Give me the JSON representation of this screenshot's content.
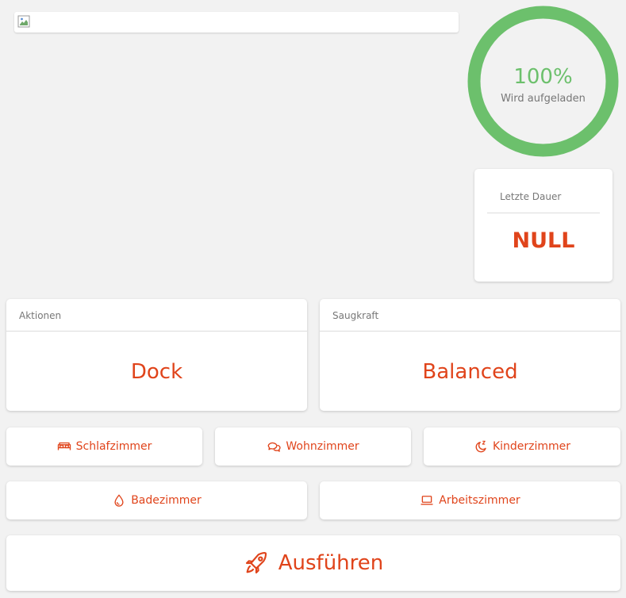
{
  "battery": {
    "percent_label": "100%",
    "status": "Wird aufgeladen",
    "level": 1.0,
    "color": "#6cc06c"
  },
  "last_duration": {
    "label": "Letzte Dauer",
    "value": "NULL"
  },
  "actions": {
    "label": "Aktionen",
    "value": "Dock"
  },
  "suction": {
    "label": "Saugkraft",
    "value": "Balanced"
  },
  "rooms": [
    {
      "label": "Schlafzimmer",
      "icon": "bed-icon"
    },
    {
      "label": "Wohnzimmer",
      "icon": "chat-bubbles-icon"
    },
    {
      "label": "Kinderzimmer",
      "icon": "moon-sleep-icon"
    },
    {
      "label": "Badezimmer",
      "icon": "water-drop-icon"
    },
    {
      "label": "Arbeitszimmer",
      "icon": "laptop-icon"
    }
  ],
  "run": {
    "label": "Ausführen",
    "icon": "rocket-icon"
  },
  "colors": {
    "accent": "#e0441b",
    "background": "#f2f2f2"
  }
}
